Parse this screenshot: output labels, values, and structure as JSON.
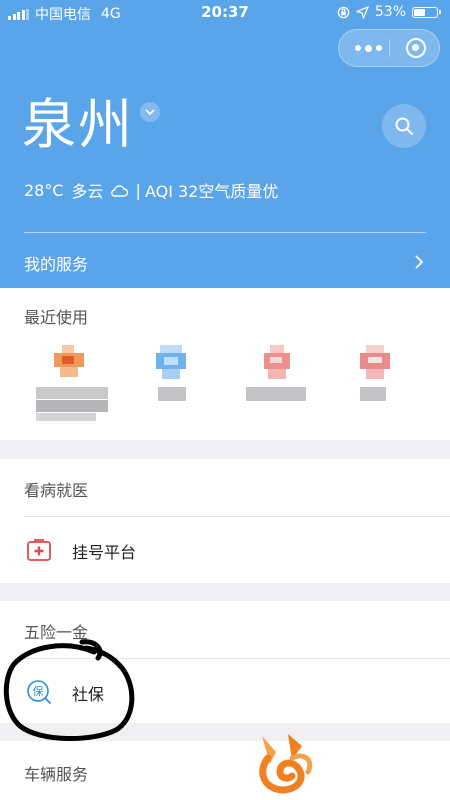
{
  "status_bar": {
    "carrier": "中国电信",
    "network": "4G",
    "time": "20:37",
    "battery": "53%",
    "battery_level": 0.53
  },
  "header": {
    "city": "泉州",
    "weather": {
      "temp": "28°C",
      "condition": "多云",
      "separator": "|",
      "aqi": "AQI 32空气质量优"
    },
    "my_services_label": "我的服务"
  },
  "sections": {
    "recent": {
      "title": "最近使用"
    },
    "medical": {
      "title": "看病就医",
      "items": [
        {
          "label": "挂号平台",
          "icon": "hospital-kit-icon",
          "color": "#e0484a"
        }
      ]
    },
    "insurance": {
      "title": "五险一金",
      "items": [
        {
          "label": "社保",
          "icon": "social-security-icon",
          "color": "#2f8be0"
        }
      ]
    },
    "vehicle": {
      "title": "车辆服务"
    }
  },
  "colors": {
    "header_bg": "#5aa5ea",
    "page_bg": "#f0f0f2",
    "annotation": "#000000",
    "logo": "#f08020"
  }
}
